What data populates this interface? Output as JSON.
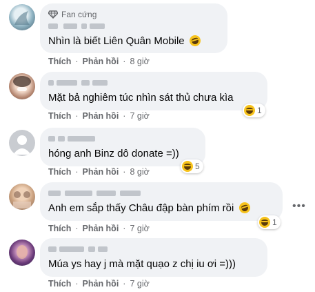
{
  "comments": [
    {
      "badge": "Fan cứng",
      "text": "Nhìn là biết Liên Quân Mobile",
      "action_like": "Thích",
      "action_reply": "Phản hồi",
      "time": "8 giờ"
    },
    {
      "text": "Mặt bả nghiêm túc nhìn sát thủ chưa kìa",
      "action_like": "Thích",
      "action_reply": "Phản hồi",
      "time": "7 giờ",
      "reaction_count": "1"
    },
    {
      "text": "hóng anh Binz dô donate =))",
      "action_like": "Thích",
      "action_reply": "Phản hồi",
      "time": "8 giờ",
      "reaction_count": "5"
    },
    {
      "text": "Anh em sắp thấy Châu đập bàn phím rồi",
      "action_like": "Thích",
      "action_reply": "Phản hồi",
      "time": "7 giờ",
      "reaction_count": "1"
    },
    {
      "text": "Múa ys hay j mà mặt quạo z chị iu ơi =)))",
      "action_like": "Thích",
      "action_reply": "Phản hồi",
      "time": "7 giờ"
    }
  ],
  "separator": "·",
  "more_options": "•••",
  "colors": {
    "bubble": "#f0f2f5",
    "meta_text": "#65676b",
    "emoji": "#f7c31c"
  }
}
